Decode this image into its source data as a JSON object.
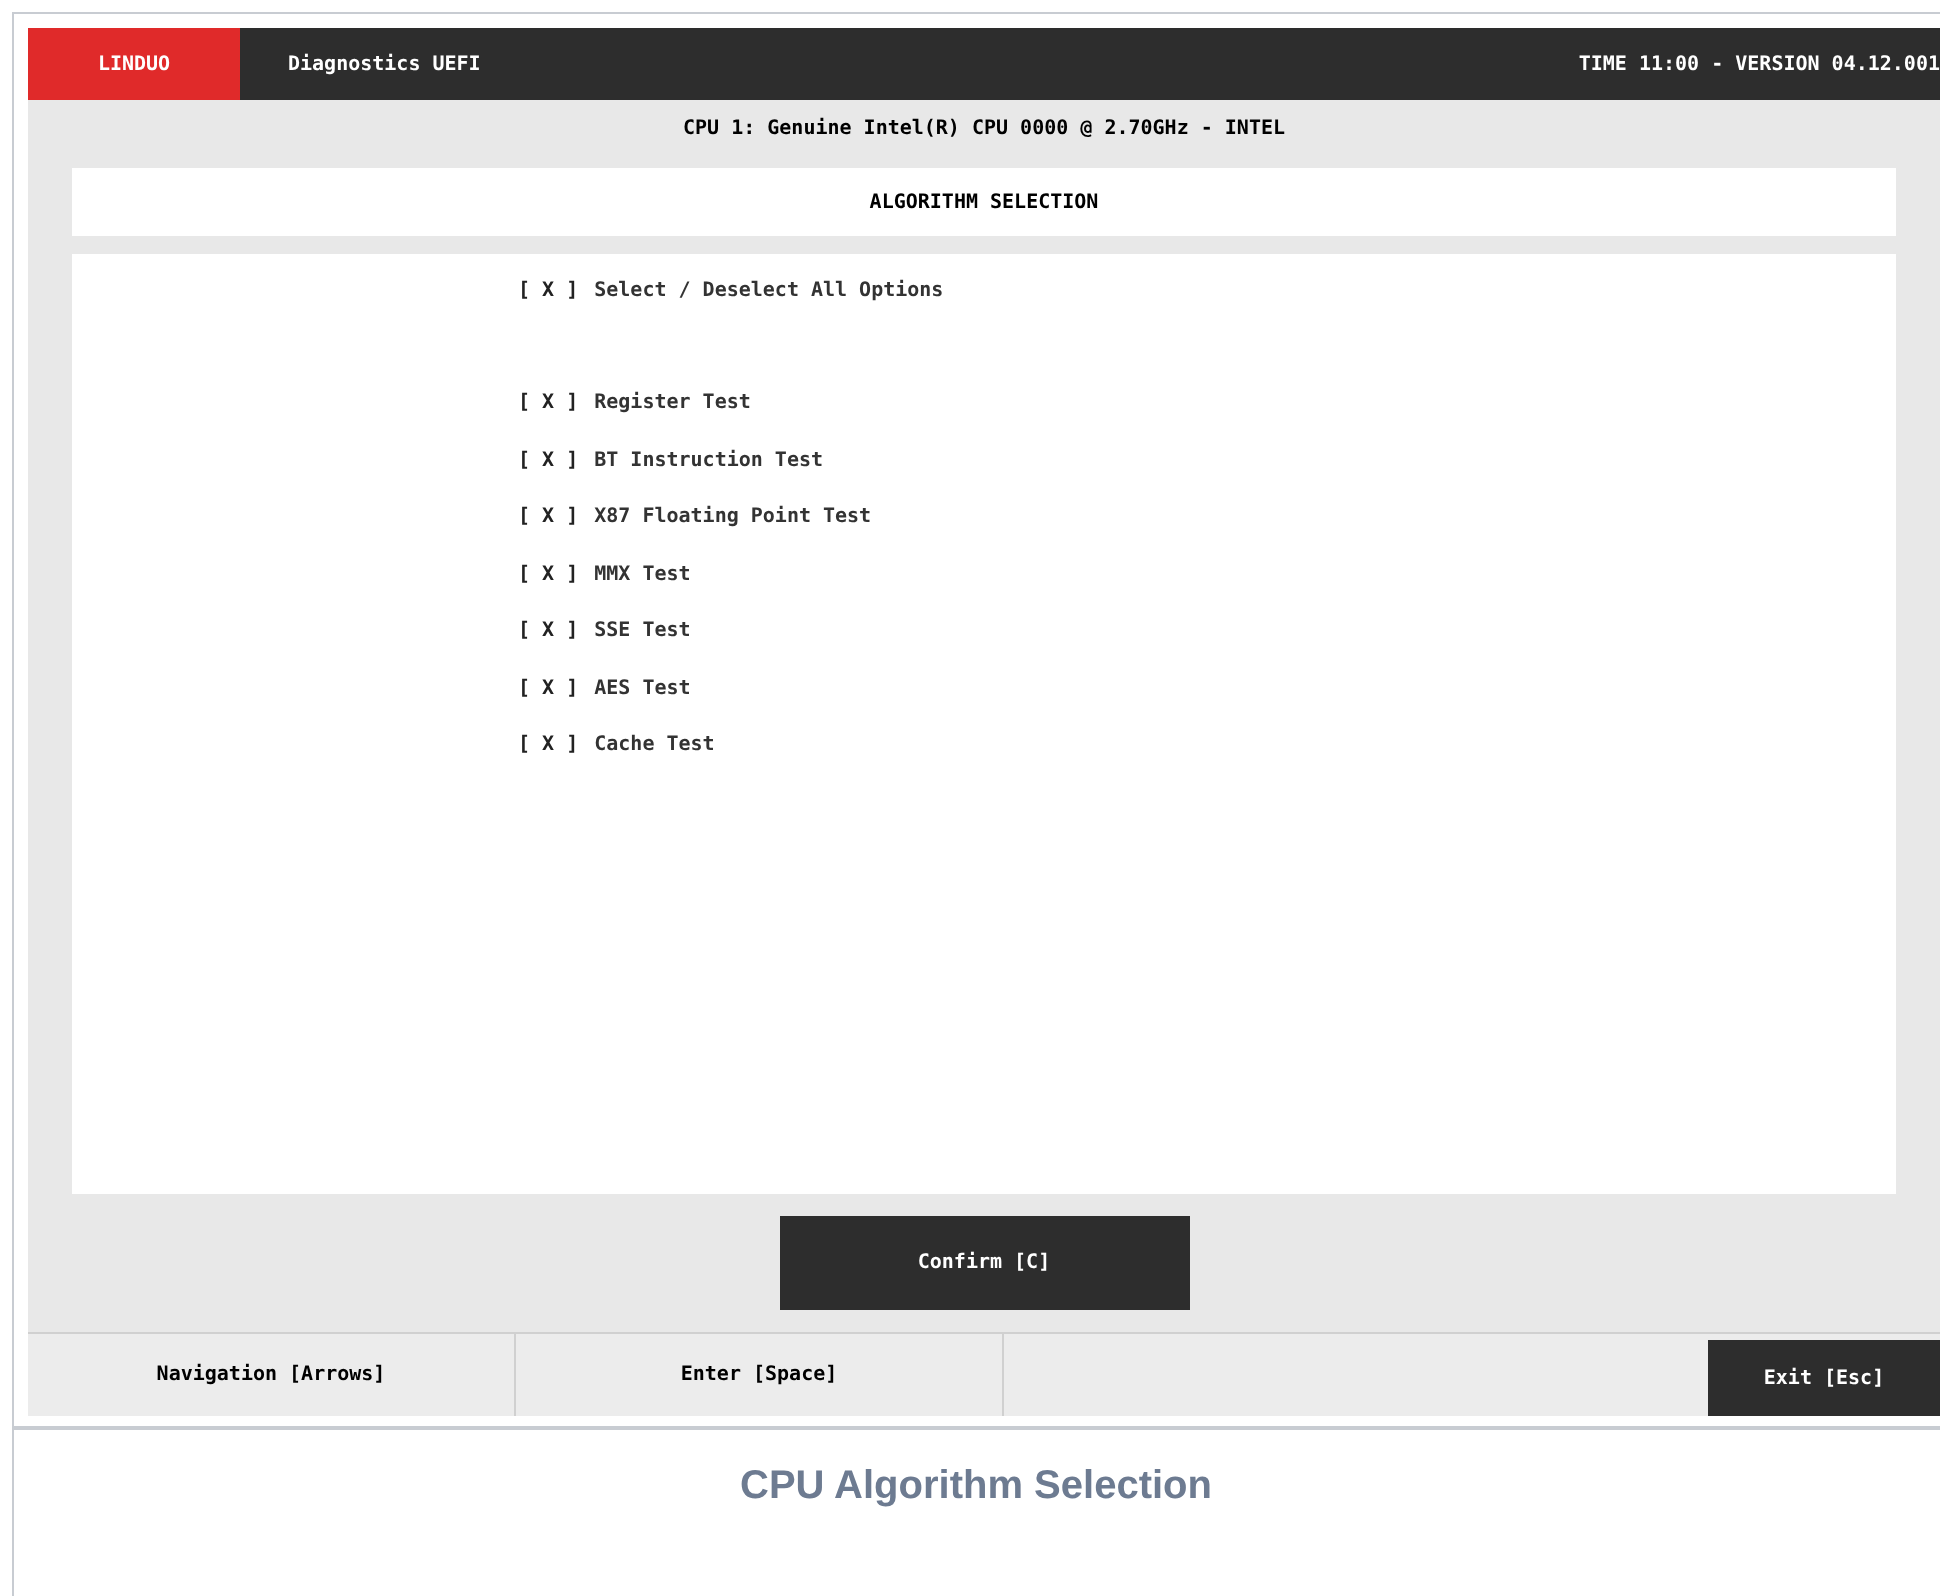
{
  "header": {
    "brand": "LINDUO",
    "app": "Diagnostics UEFI",
    "time_version": "TIME 11:00 - VERSION 04.12.001"
  },
  "cpu_line": "CPU 1: Genuine Intel(R) CPU 0000 @ 2.70GHz - INTEL",
  "section_title": "ALGORITHM SELECTION",
  "select_all": {
    "box": "[ X ]",
    "label": "Select / Deselect All Options",
    "checked": true
  },
  "options": [
    {
      "box": "[ X ]",
      "label": "Register Test",
      "checked": true
    },
    {
      "box": "[ X ]",
      "label": "BT Instruction Test",
      "checked": true
    },
    {
      "box": "[ X ]",
      "label": "X87 Floating Point Test",
      "checked": true
    },
    {
      "box": "[ X ]",
      "label": "MMX Test",
      "checked": true
    },
    {
      "box": "[ X ]",
      "label": "SSE Test",
      "checked": true
    },
    {
      "box": "[ X ]",
      "label": "AES Test",
      "checked": true
    },
    {
      "box": "[ X ]",
      "label": "Cache Test",
      "checked": true
    }
  ],
  "confirm_button": "Confirm [C]",
  "footer": {
    "navigation": "Navigation [Arrows]",
    "enter": "Enter [Space]",
    "exit": "Exit [Esc]"
  },
  "caption": "CPU Algorithm Selection"
}
